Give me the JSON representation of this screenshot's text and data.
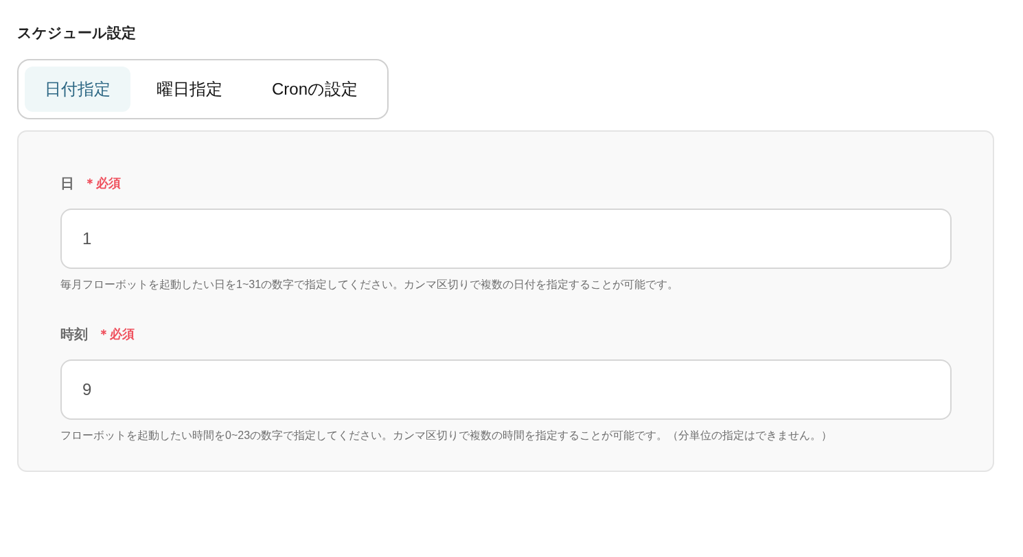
{
  "section_title": "スケジュール設定",
  "tabs": [
    {
      "label": "日付指定",
      "selected": true
    },
    {
      "label": "曜日指定",
      "selected": false
    },
    {
      "label": "Cronの設定",
      "selected": false
    }
  ],
  "fields": [
    {
      "label": "日",
      "required": true,
      "required_mark": "＊",
      "required_label": "必須",
      "value": "1",
      "help": "毎月フローボットを起動したい日を1~31の数字で指定してください。カンマ区切りで複数の日付を指定することが可能です。"
    },
    {
      "label": "時刻",
      "required": true,
      "required_mark": "＊",
      "required_label": "必須",
      "value": "9",
      "help": "フローボットを起動したい時間を0~23の数字で指定してください。カンマ区切りで複数の時間を指定することが可能です。（分単位の指定はできません。）"
    }
  ]
}
